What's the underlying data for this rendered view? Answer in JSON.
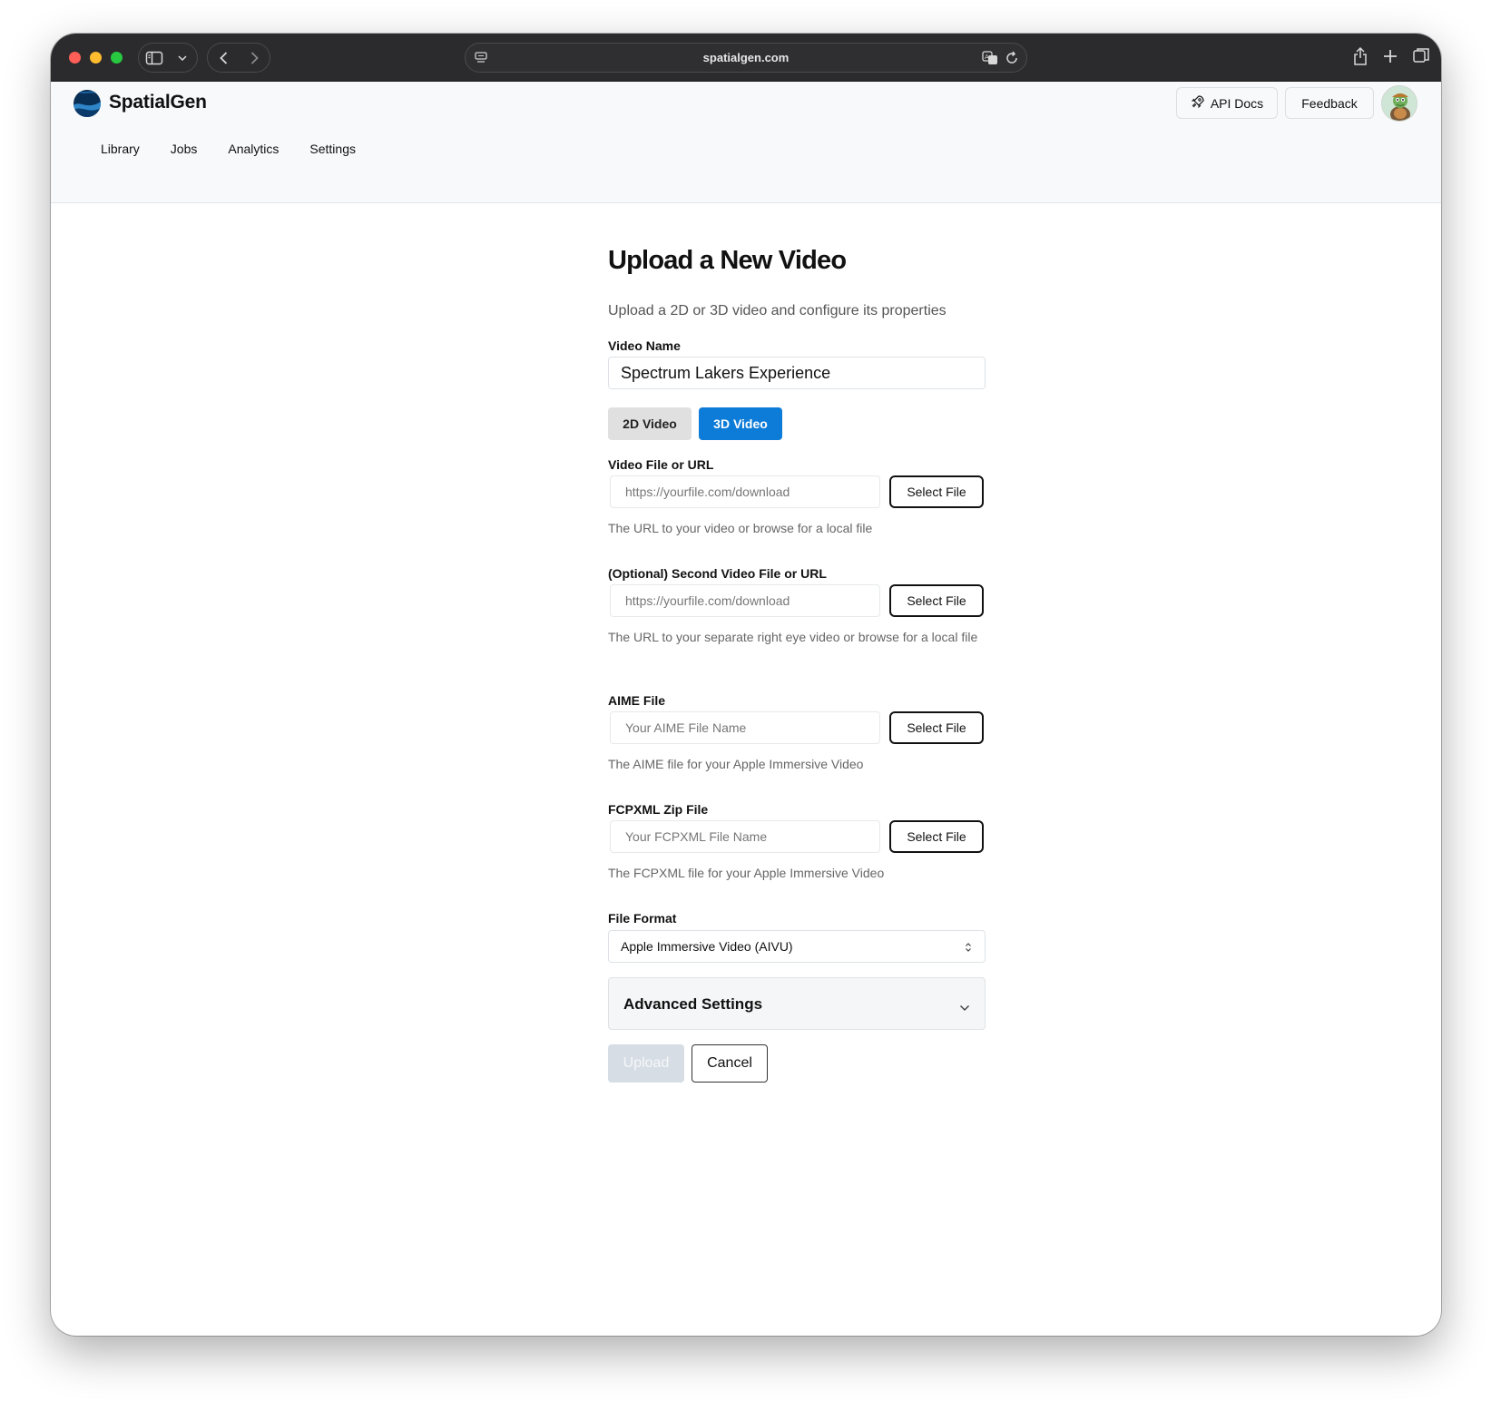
{
  "browser": {
    "url": "spatialgen.com"
  },
  "header": {
    "brand": "SpatialGen",
    "api_docs_label": "API Docs",
    "feedback_label": "Feedback"
  },
  "nav": {
    "items": [
      "Library",
      "Jobs",
      "Analytics",
      "Settings"
    ]
  },
  "form": {
    "title": "Upload a New Video",
    "subtitle": "Upload a 2D or 3D video and configure its properties",
    "video_name": {
      "label": "Video Name",
      "value": "Spectrum Lakers Experience"
    },
    "video_type": {
      "options": [
        "2D Video",
        "3D Video"
      ],
      "selected": "3D Video"
    },
    "video_file": {
      "label": "Video File or URL",
      "placeholder": "https://yourfile.com/download",
      "button": "Select File",
      "help": "The URL to your video or browse for a local file"
    },
    "second_video_file": {
      "label": "(Optional) Second Video File or URL",
      "placeholder": "https://yourfile.com/download",
      "button": "Select File",
      "help": "The URL to your separate right eye video or browse for a local file"
    },
    "aime_file": {
      "label": "AIME File",
      "placeholder": "Your AIME File Name",
      "button": "Select File",
      "help": "The AIME file for your Apple Immersive Video"
    },
    "fcpxml_file": {
      "label": "FCPXML Zip File",
      "placeholder": "Your FCPXML File Name",
      "button": "Select File",
      "help": "The FCPXML file for your Apple Immersive Video"
    },
    "file_format": {
      "label": "File Format",
      "selected": "Apple Immersive Video (AIVU)"
    },
    "advanced_settings_label": "Advanced Settings",
    "upload_label": "Upload",
    "cancel_label": "Cancel"
  },
  "icons": {
    "sidebar": "sidebar-icon",
    "back": "chevron-left-icon",
    "forward": "chevron-right-icon",
    "translate": "translate-icon",
    "reload": "reload-icon",
    "share": "share-icon",
    "new_tab": "plus-icon",
    "tabs": "tabs-overview-icon",
    "rocket": "rocket-icon"
  },
  "colors": {
    "accent": "#0d7cd8",
    "titlebar": "#2b2b2d",
    "header_bg": "#f8f9fa",
    "upload_disabled": "#d6dde4"
  }
}
